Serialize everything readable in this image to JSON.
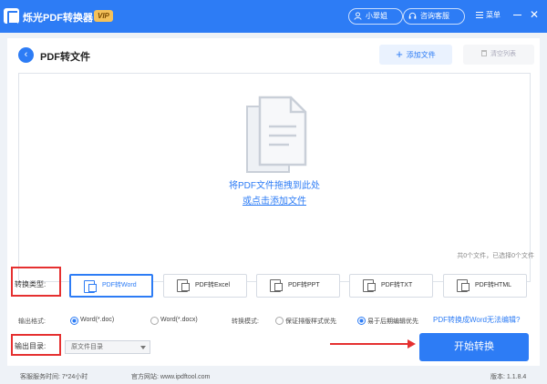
{
  "titlebar": {
    "app_title": "烁光PDF转换器",
    "vip_badge": "VIP",
    "user_button": "小翠姐",
    "service_button": "咨询客服",
    "menu_label": "菜单",
    "close_glyph": "✕"
  },
  "header": {
    "back_glyph": "‹",
    "page_title": "PDF转文件",
    "add_file_label": "添加文件",
    "clear_list_label": "清空列表"
  },
  "dropzone": {
    "hint": "将PDF文件拖拽到此处",
    "link": "或点击添加文件"
  },
  "file_count": "共0个文件，已选择0个文件",
  "conversion": {
    "label": "转换类型:",
    "types": [
      {
        "label": "PDF转Word",
        "active": true
      },
      {
        "label": "PDF转Excel",
        "active": false
      },
      {
        "label": "PDF转PPT",
        "active": false
      },
      {
        "label": "PDF转TXT",
        "active": false
      },
      {
        "label": "PDF转HTML",
        "active": false
      }
    ]
  },
  "output_format": {
    "label": "输出格式:",
    "options": [
      "Word(*.doc)",
      "Word(*.docx)"
    ],
    "selected": "Word(*.doc)"
  },
  "conversion_mode": {
    "label": "转换模式:",
    "options": [
      "保证排版样式优先",
      "易于后期编辑优先"
    ],
    "selected": "易于后期编辑优先"
  },
  "word_help_link": "PDF转换成Word无法编辑?",
  "output_dir": {
    "label": "输出目录:",
    "value": "原文件目录"
  },
  "start_button": "开始转换",
  "footer": {
    "service_hours": "客服服务时间: 7*24小时",
    "website": "官方网站: www.ipdftool.com",
    "version": "版本: 1.1.8.4"
  },
  "colors": {
    "accent": "#2d7cf5",
    "highlight": "#e53030"
  }
}
